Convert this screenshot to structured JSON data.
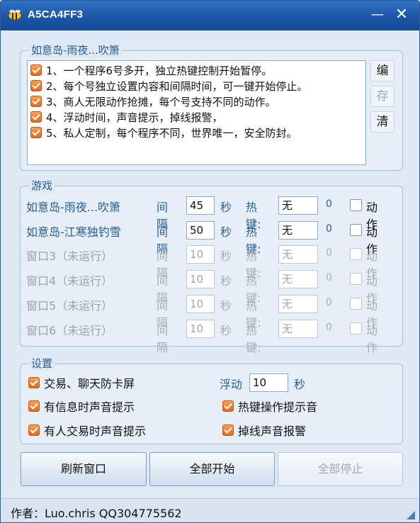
{
  "window": {
    "title": "A5CA4FF3",
    "minimize": "—",
    "close": "✕"
  },
  "script_group": {
    "legend": "如意岛-雨夜...吹箫",
    "lines": [
      {
        "text": "1、一个程序6号多开，独立热键控制开始暂停。",
        "checked": true
      },
      {
        "text": "2、每个号独立设置内容和间隔时间，可一键开始停止。",
        "checked": true
      },
      {
        "text": "3、商人无限动作抢摊，每个号支持不同的动作。",
        "checked": true
      },
      {
        "text": "4、浮动时间，声音提示，掉线报警，",
        "checked": true
      },
      {
        "text": "5、私人定制，每个程序不同，世界唯一，安全防封。",
        "checked": true
      }
    ],
    "side_buttons": {
      "edit": "编",
      "save": "存",
      "clear": "清"
    }
  },
  "game_group": {
    "legend": "游戏",
    "interval_label": "间隔",
    "seconds_label": "秒",
    "hotkey_label": "热键:",
    "action_label": "动作",
    "rows": [
      {
        "name": "如意岛-雨夜...吹箫",
        "interval": "45",
        "hotkey": "无",
        "count": "0",
        "enabled": true
      },
      {
        "name": "如意岛-江寒独钓雪",
        "interval": "50",
        "hotkey": "无",
        "count": "0",
        "enabled": true
      },
      {
        "name": "窗口3（未运行）",
        "interval": "10",
        "hotkey": "无",
        "count": "0",
        "enabled": false
      },
      {
        "name": "窗口4（未运行）",
        "interval": "10",
        "hotkey": "无",
        "count": "0",
        "enabled": false
      },
      {
        "name": "窗口5（未运行）",
        "interval": "10",
        "hotkey": "无",
        "count": "0",
        "enabled": false
      },
      {
        "name": "窗口6（未运行）",
        "interval": "10",
        "hotkey": "无",
        "count": "0",
        "enabled": false
      }
    ]
  },
  "settings_group": {
    "legend": "设置",
    "anti_freeze": "交易、聊天防卡屏",
    "msg_sound": "有信息时声音提示",
    "trade_sound": "有人交易时声音提示",
    "float_label": "浮动",
    "float_value": "10",
    "float_unit": "秒",
    "hotkey_sound": "热键操作提示音",
    "disconnect_alarm": "掉线声音报警"
  },
  "buttons": {
    "refresh": "刷新窗口",
    "start_all": "全部开始",
    "stop_all": "全部停止"
  },
  "status_bar": {
    "author": "作者：Luo.chris   QQ304775562"
  },
  "colors": {
    "title_bar": "#1c56a8",
    "label_blue": "#2b5d91",
    "check_orange": "#e26a1d",
    "window_bg": "#dfe9f4"
  }
}
